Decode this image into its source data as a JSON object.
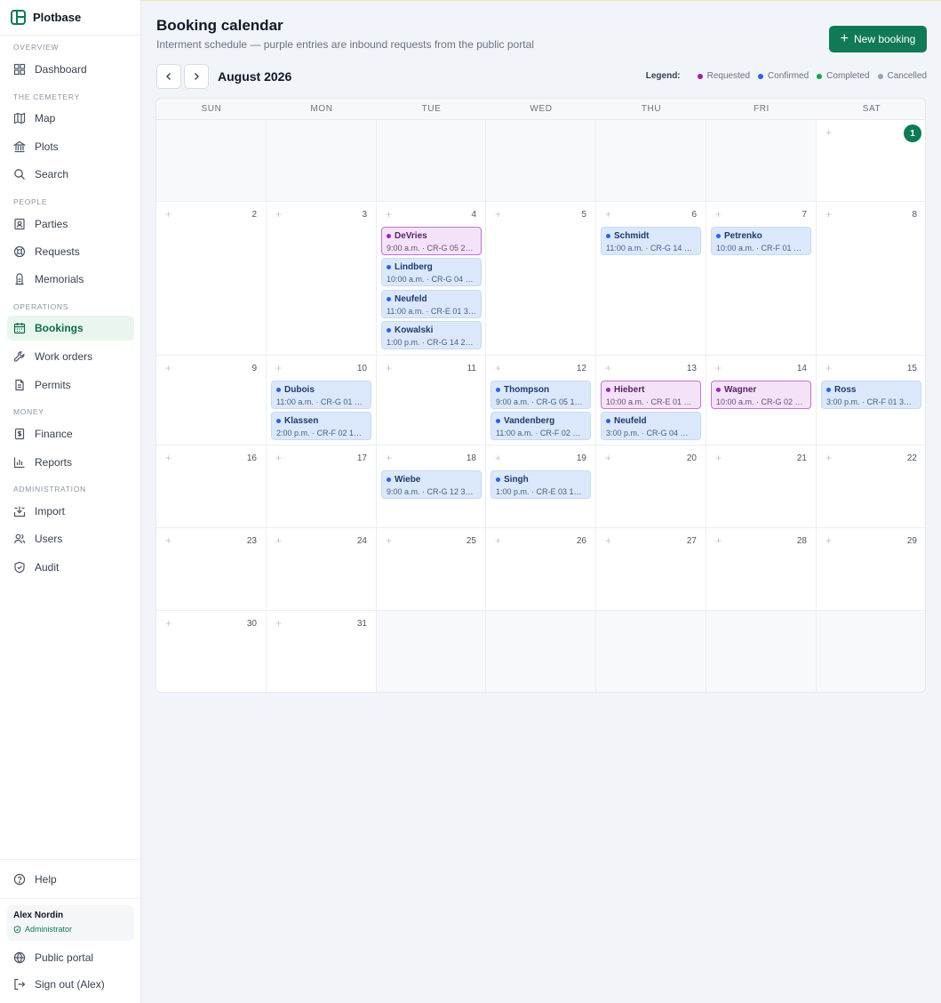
{
  "app": {
    "name": "Plotbase"
  },
  "sidebar": {
    "sections": {
      "overview": "OVERVIEW",
      "cemetery": "THE CEMETERY",
      "people": "PEOPLE",
      "operations": "OPERATIONS",
      "money": "MONEY",
      "administration": "ADMINISTRATION"
    },
    "items": {
      "dashboard": "Dashboard",
      "map": "Map",
      "plots": "Plots",
      "search": "Search",
      "parties": "Parties",
      "requests": "Requests",
      "memorials": "Memorials",
      "bookings": "Bookings",
      "work_orders": "Work orders",
      "permits": "Permits",
      "finance": "Finance",
      "reports": "Reports",
      "import": "Import",
      "users": "Users",
      "audit": "Audit",
      "help": "Help",
      "public_portal": "Public portal",
      "sign_out": "Sign out (Alex)"
    },
    "user": {
      "name": "Alex Nordin",
      "role": "Administrator"
    }
  },
  "header": {
    "title": "Booking calendar",
    "subtitle": "Interment schedule — purple entries are inbound requests from the public portal",
    "new_booking": "New booking",
    "month": "August 2026"
  },
  "legend": {
    "label": "Legend:",
    "items": [
      {
        "label": "Requested",
        "color": "#a21caf"
      },
      {
        "label": "Confirmed",
        "color": "#2563eb"
      },
      {
        "label": "Completed",
        "color": "#16a34a"
      },
      {
        "label": "Cancelled",
        "color": "#94a3b8"
      }
    ]
  },
  "calendar": {
    "weekdays": [
      "SUN",
      "MON",
      "TUE",
      "WED",
      "THU",
      "FRI",
      "SAT"
    ],
    "today": "1",
    "days": {
      "d1": "1",
      "d2": "2",
      "d3": "3",
      "d4": "4",
      "d5": "5",
      "d6": "6",
      "d7": "7",
      "d8": "8",
      "d9": "9",
      "d10": "10",
      "d11": "11",
      "d12": "12",
      "d13": "13",
      "d14": "14",
      "d15": "15",
      "d16": "16",
      "d17": "17",
      "d18": "18",
      "d19": "19",
      "d20": "20",
      "d21": "21",
      "d22": "22",
      "d23": "23",
      "d24": "24",
      "d25": "25",
      "d26": "26",
      "d27": "27",
      "d28": "28",
      "d29": "29",
      "d30": "30",
      "d31": "31"
    },
    "add_symbol": "+",
    "events": {
      "devries": {
        "name": "DeVries",
        "time": "9:00 a.m. · CR-G 05 2…",
        "status": "requested"
      },
      "lindberg": {
        "name": "Lindberg",
        "time": "10:00 a.m. · CR-G 04 …",
        "status": "confirmed"
      },
      "neufeld4": {
        "name": "Neufeld",
        "time": "11:00 a.m. · CR-E 01 3…",
        "status": "confirmed"
      },
      "kowalski": {
        "name": "Kowalski",
        "time": "1:00 p.m. · CR-G 14 2…",
        "status": "confirmed"
      },
      "schmidt": {
        "name": "Schmidt",
        "time": "11:00 a.m. · CR-G 14 …",
        "status": "confirmed"
      },
      "petrenko": {
        "name": "Petrenko",
        "time": "10:00 a.m. · CR-F 01 1…",
        "status": "confirmed"
      },
      "dubois": {
        "name": "Dubois",
        "time": "11:00 a.m. · CR-G 01 1…",
        "status": "confirmed"
      },
      "klassen": {
        "name": "Klassen",
        "time": "2:00 p.m. · CR-F 02 1…",
        "status": "confirmed"
      },
      "thompson": {
        "name": "Thompson",
        "time": "9:00 a.m. · CR-G 05 1…",
        "status": "confirmed"
      },
      "vandenberg": {
        "name": "Vandenberg",
        "time": "11:00 a.m. · CR-F 02 …",
        "status": "confirmed"
      },
      "hiebert": {
        "name": "Hiebert",
        "time": "10:00 a.m. · CR-E 01 1…",
        "status": "requested"
      },
      "neufeld13": {
        "name": "Neufeld",
        "time": "3:00 p.m. · CR-G 04 …",
        "status": "confirmed"
      },
      "wagner": {
        "name": "Wagner",
        "time": "10:00 a.m. · CR-G 02 …",
        "status": "requested"
      },
      "ross": {
        "name": "Ross",
        "time": "3:00 p.m. · CR-F 01 3…",
        "status": "confirmed"
      },
      "wiebe": {
        "name": "Wiebe",
        "time": "9:00 a.m. · CR-G 12 3…",
        "status": "confirmed"
      },
      "singh": {
        "name": "Singh",
        "time": "1:00 p.m. · CR-E 03 1…",
        "status": "confirmed"
      }
    }
  }
}
